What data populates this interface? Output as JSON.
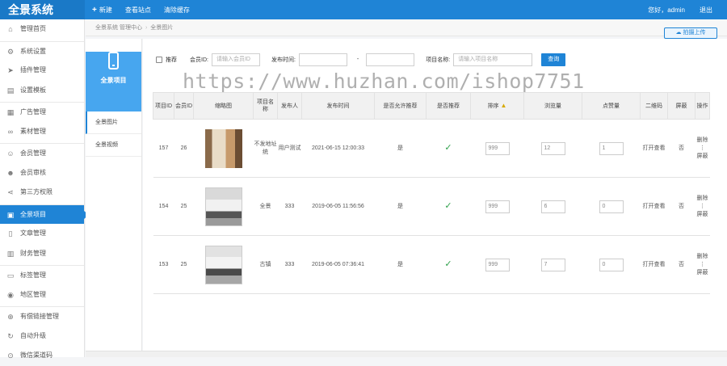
{
  "app": {
    "title": "全景系统"
  },
  "topnav": [
    {
      "label": "新建",
      "icon": "plus-icon"
    },
    {
      "label": "查看站点"
    },
    {
      "label": "清除缓存"
    }
  ],
  "user": {
    "greeting": "您好，admin",
    "logout": "退出"
  },
  "sidebar": {
    "items": [
      {
        "label": "管理首页",
        "icon": "home-icon"
      },
      {
        "label": "系统设置",
        "icon": "gear-icon"
      },
      {
        "label": "插件管理",
        "icon": "send-icon"
      },
      {
        "label": "设置模板",
        "icon": "template-icon"
      },
      {
        "label": "广告管理",
        "icon": "ad-icon"
      },
      {
        "label": "素材管理",
        "icon": "link-icon"
      },
      {
        "label": "会员管理",
        "icon": "user-icon"
      },
      {
        "label": "会员审核",
        "icon": "user-check-icon"
      },
      {
        "label": "第三方权限",
        "icon": "share-icon"
      },
      {
        "label": "全景项目",
        "icon": "panorama-icon"
      },
      {
        "label": "文章管理",
        "icon": "doc-icon"
      },
      {
        "label": "财务管理",
        "icon": "finance-icon"
      },
      {
        "label": "标签管理",
        "icon": "tag-icon"
      },
      {
        "label": "地区管理",
        "icon": "globe-icon"
      },
      {
        "label": "有偿链接管理",
        "icon": "paid-link-icon"
      },
      {
        "label": "自动升级",
        "icon": "upgrade-icon"
      },
      {
        "label": "微信渠道码",
        "icon": "wechat-icon"
      }
    ]
  },
  "breadcrumb": [
    "全景系统 管理中心",
    "全景图片"
  ],
  "upload_btn": "拍摄上传",
  "left_panel": {
    "title": "全景项目",
    "tabs": [
      "全景图片",
      "全景视频"
    ]
  },
  "filter": {
    "recommend": "推荐",
    "member_id_label": "会员ID:",
    "member_id_placeholder": "请输入会员ID",
    "time_label": "发布时间:",
    "dash": "-",
    "name_label": "项目名称:",
    "name_placeholder": "请输入项目名称",
    "search": "查询"
  },
  "watermark": "https://www.huzhan.com/ishop7751",
  "table": {
    "headers": [
      "项目ID",
      "会员ID",
      "缩略图",
      "项目名称",
      "发布人",
      "发布时间",
      "是否允许推荐",
      "是否推荐",
      "排序",
      "浏览量",
      "点赞量",
      "二维码",
      "屏蔽",
      "操作"
    ],
    "rows": [
      {
        "id": "157",
        "member": "26",
        "name": "不发地址统",
        "publisher": "用户测试",
        "time": "2021-06-15 12:00:33",
        "allow": "是",
        "sort": "999",
        "views": "12",
        "likes": "1",
        "qr": "打开查看",
        "block": "否",
        "op1": "删除",
        "op2": "屏蔽"
      },
      {
        "id": "154",
        "member": "25",
        "name": "全景",
        "publisher": "333",
        "time": "2019-06-05 11:56:56",
        "allow": "是",
        "sort": "999",
        "views": "6",
        "likes": "0",
        "qr": "打开查看",
        "block": "否",
        "op1": "删除",
        "op2": "屏蔽"
      },
      {
        "id": "153",
        "member": "25",
        "name": "古镇",
        "publisher": "333",
        "time": "2019-06-05 07:36:41",
        "allow": "是",
        "sort": "999",
        "views": "7",
        "likes": "0",
        "qr": "打开查看",
        "block": "否",
        "op1": "删除",
        "op2": "屏蔽"
      }
    ]
  }
}
